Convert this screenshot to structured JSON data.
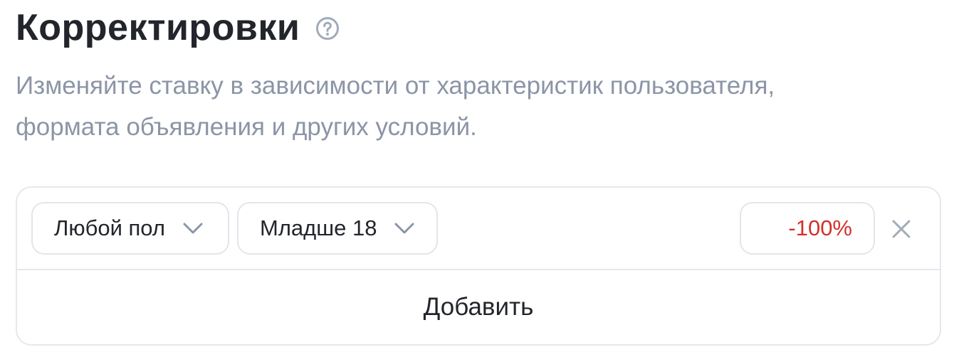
{
  "header": {
    "title": "Корректировки",
    "help_icon": "question-circle-icon"
  },
  "description": {
    "line1": "Изменяйте ставку в зависимости от характеристик пользователя,",
    "line2": "формата объявления и других условий."
  },
  "adjustment": {
    "gender_select": {
      "value": "Любой пол",
      "icon": "chevron-down-icon"
    },
    "age_select": {
      "value": "Младше 18",
      "icon": "chevron-down-icon"
    },
    "bid_value": "-100%",
    "remove_icon": "close-icon"
  },
  "add_button": {
    "label": "Добавить"
  },
  "colors": {
    "title": "#22252b",
    "description": "#8b95a6",
    "negative_value": "#d4302b",
    "border": "#e6e8ec",
    "icon_gray": "#a2abb8"
  }
}
